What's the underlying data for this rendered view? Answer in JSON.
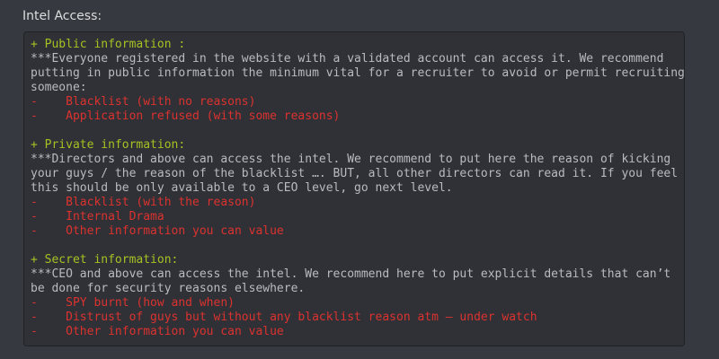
{
  "header": {
    "label": "Intel Access:"
  },
  "code_block": {
    "lines": [
      {
        "kind": "green",
        "text": "+ Public information :"
      },
      {
        "kind": "text",
        "text": "***Everyone registered in the website with a validated account can access it. We recommend"
      },
      {
        "kind": "text",
        "text": "putting in public information the minimum vital for a recruiter to avoid or permit recruiting"
      },
      {
        "kind": "text",
        "text": "someone:"
      },
      {
        "kind": "red",
        "text": "-    Blacklist (with no reasons)"
      },
      {
        "kind": "red",
        "text": "-    Application refused (with some reasons)"
      },
      {
        "kind": "blank",
        "text": ""
      },
      {
        "kind": "green",
        "text": "+ Private information:"
      },
      {
        "kind": "text",
        "text": "***Directors and above can access the intel. We recommend to put here the reason of kicking"
      },
      {
        "kind": "text",
        "text": "your guys / the reason of the blacklist …. BUT, all other directors can read it. If you feel"
      },
      {
        "kind": "text",
        "text": "this should be only available to a CEO level, go next level."
      },
      {
        "kind": "red",
        "text": "-    Blacklist (with the reason)"
      },
      {
        "kind": "red",
        "text": "-    Internal Drama"
      },
      {
        "kind": "red",
        "text": "-    Other information you can value"
      },
      {
        "kind": "blank",
        "text": ""
      },
      {
        "kind": "green",
        "text": "+ Secret information:"
      },
      {
        "kind": "text",
        "text": "***CEO and above can access the intel. We recommend here to put explicit details that can’t"
      },
      {
        "kind": "text",
        "text": "be done for security reasons elsewhere."
      },
      {
        "kind": "red",
        "text": "-    SPY burnt (how and when)"
      },
      {
        "kind": "red",
        "text": "-    Distrust of guys but without any blacklist reason atm – under watch"
      },
      {
        "kind": "red",
        "text": "-    Other information you can value"
      }
    ]
  },
  "colors": {
    "background": "#36393f",
    "code_background": "#2f3136",
    "heading_green": "#a8c023",
    "body_text": "#b9bbbe",
    "bullet_red": "#dc322f"
  }
}
